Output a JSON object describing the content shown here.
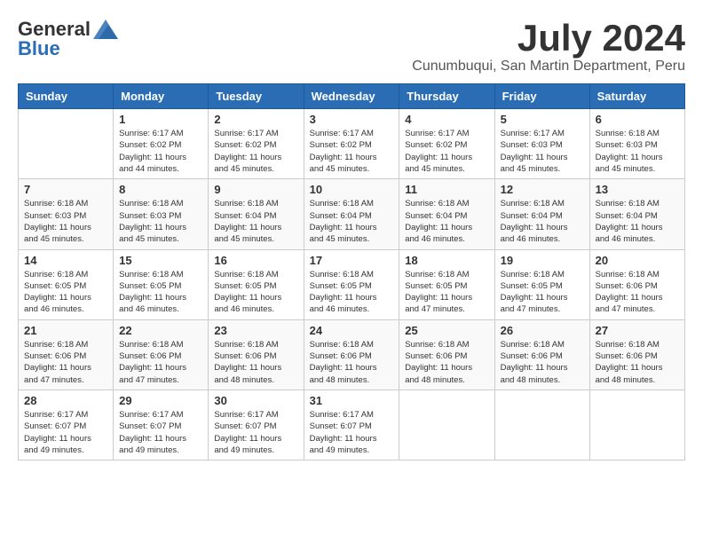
{
  "header": {
    "logo_general": "General",
    "logo_blue": "Blue",
    "month_title": "July 2024",
    "location": "Cunumbuqui, San Martin Department, Peru"
  },
  "calendar": {
    "days_of_week": [
      "Sunday",
      "Monday",
      "Tuesday",
      "Wednesday",
      "Thursday",
      "Friday",
      "Saturday"
    ],
    "weeks": [
      [
        {
          "day": "",
          "info": ""
        },
        {
          "day": "1",
          "info": "Sunrise: 6:17 AM\nSunset: 6:02 PM\nDaylight: 11 hours\nand 44 minutes."
        },
        {
          "day": "2",
          "info": "Sunrise: 6:17 AM\nSunset: 6:02 PM\nDaylight: 11 hours\nand 45 minutes."
        },
        {
          "day": "3",
          "info": "Sunrise: 6:17 AM\nSunset: 6:02 PM\nDaylight: 11 hours\nand 45 minutes."
        },
        {
          "day": "4",
          "info": "Sunrise: 6:17 AM\nSunset: 6:02 PM\nDaylight: 11 hours\nand 45 minutes."
        },
        {
          "day": "5",
          "info": "Sunrise: 6:17 AM\nSunset: 6:03 PM\nDaylight: 11 hours\nand 45 minutes."
        },
        {
          "day": "6",
          "info": "Sunrise: 6:18 AM\nSunset: 6:03 PM\nDaylight: 11 hours\nand 45 minutes."
        }
      ],
      [
        {
          "day": "7",
          "info": "Sunrise: 6:18 AM\nSunset: 6:03 PM\nDaylight: 11 hours\nand 45 minutes."
        },
        {
          "day": "8",
          "info": "Sunrise: 6:18 AM\nSunset: 6:03 PM\nDaylight: 11 hours\nand 45 minutes."
        },
        {
          "day": "9",
          "info": "Sunrise: 6:18 AM\nSunset: 6:04 PM\nDaylight: 11 hours\nand 45 minutes."
        },
        {
          "day": "10",
          "info": "Sunrise: 6:18 AM\nSunset: 6:04 PM\nDaylight: 11 hours\nand 45 minutes."
        },
        {
          "day": "11",
          "info": "Sunrise: 6:18 AM\nSunset: 6:04 PM\nDaylight: 11 hours\nand 46 minutes."
        },
        {
          "day": "12",
          "info": "Sunrise: 6:18 AM\nSunset: 6:04 PM\nDaylight: 11 hours\nand 46 minutes."
        },
        {
          "day": "13",
          "info": "Sunrise: 6:18 AM\nSunset: 6:04 PM\nDaylight: 11 hours\nand 46 minutes."
        }
      ],
      [
        {
          "day": "14",
          "info": "Sunrise: 6:18 AM\nSunset: 6:05 PM\nDaylight: 11 hours\nand 46 minutes."
        },
        {
          "day": "15",
          "info": "Sunrise: 6:18 AM\nSunset: 6:05 PM\nDaylight: 11 hours\nand 46 minutes."
        },
        {
          "day": "16",
          "info": "Sunrise: 6:18 AM\nSunset: 6:05 PM\nDaylight: 11 hours\nand 46 minutes."
        },
        {
          "day": "17",
          "info": "Sunrise: 6:18 AM\nSunset: 6:05 PM\nDaylight: 11 hours\nand 46 minutes."
        },
        {
          "day": "18",
          "info": "Sunrise: 6:18 AM\nSunset: 6:05 PM\nDaylight: 11 hours\nand 47 minutes."
        },
        {
          "day": "19",
          "info": "Sunrise: 6:18 AM\nSunset: 6:05 PM\nDaylight: 11 hours\nand 47 minutes."
        },
        {
          "day": "20",
          "info": "Sunrise: 6:18 AM\nSunset: 6:06 PM\nDaylight: 11 hours\nand 47 minutes."
        }
      ],
      [
        {
          "day": "21",
          "info": "Sunrise: 6:18 AM\nSunset: 6:06 PM\nDaylight: 11 hours\nand 47 minutes."
        },
        {
          "day": "22",
          "info": "Sunrise: 6:18 AM\nSunset: 6:06 PM\nDaylight: 11 hours\nand 47 minutes."
        },
        {
          "day": "23",
          "info": "Sunrise: 6:18 AM\nSunset: 6:06 PM\nDaylight: 11 hours\nand 48 minutes."
        },
        {
          "day": "24",
          "info": "Sunrise: 6:18 AM\nSunset: 6:06 PM\nDaylight: 11 hours\nand 48 minutes."
        },
        {
          "day": "25",
          "info": "Sunrise: 6:18 AM\nSunset: 6:06 PM\nDaylight: 11 hours\nand 48 minutes."
        },
        {
          "day": "26",
          "info": "Sunrise: 6:18 AM\nSunset: 6:06 PM\nDaylight: 11 hours\nand 48 minutes."
        },
        {
          "day": "27",
          "info": "Sunrise: 6:18 AM\nSunset: 6:06 PM\nDaylight: 11 hours\nand 48 minutes."
        }
      ],
      [
        {
          "day": "28",
          "info": "Sunrise: 6:17 AM\nSunset: 6:07 PM\nDaylight: 11 hours\nand 49 minutes."
        },
        {
          "day": "29",
          "info": "Sunrise: 6:17 AM\nSunset: 6:07 PM\nDaylight: 11 hours\nand 49 minutes."
        },
        {
          "day": "30",
          "info": "Sunrise: 6:17 AM\nSunset: 6:07 PM\nDaylight: 11 hours\nand 49 minutes."
        },
        {
          "day": "31",
          "info": "Sunrise: 6:17 AM\nSunset: 6:07 PM\nDaylight: 11 hours\nand 49 minutes."
        },
        {
          "day": "",
          "info": ""
        },
        {
          "day": "",
          "info": ""
        },
        {
          "day": "",
          "info": ""
        }
      ]
    ]
  }
}
